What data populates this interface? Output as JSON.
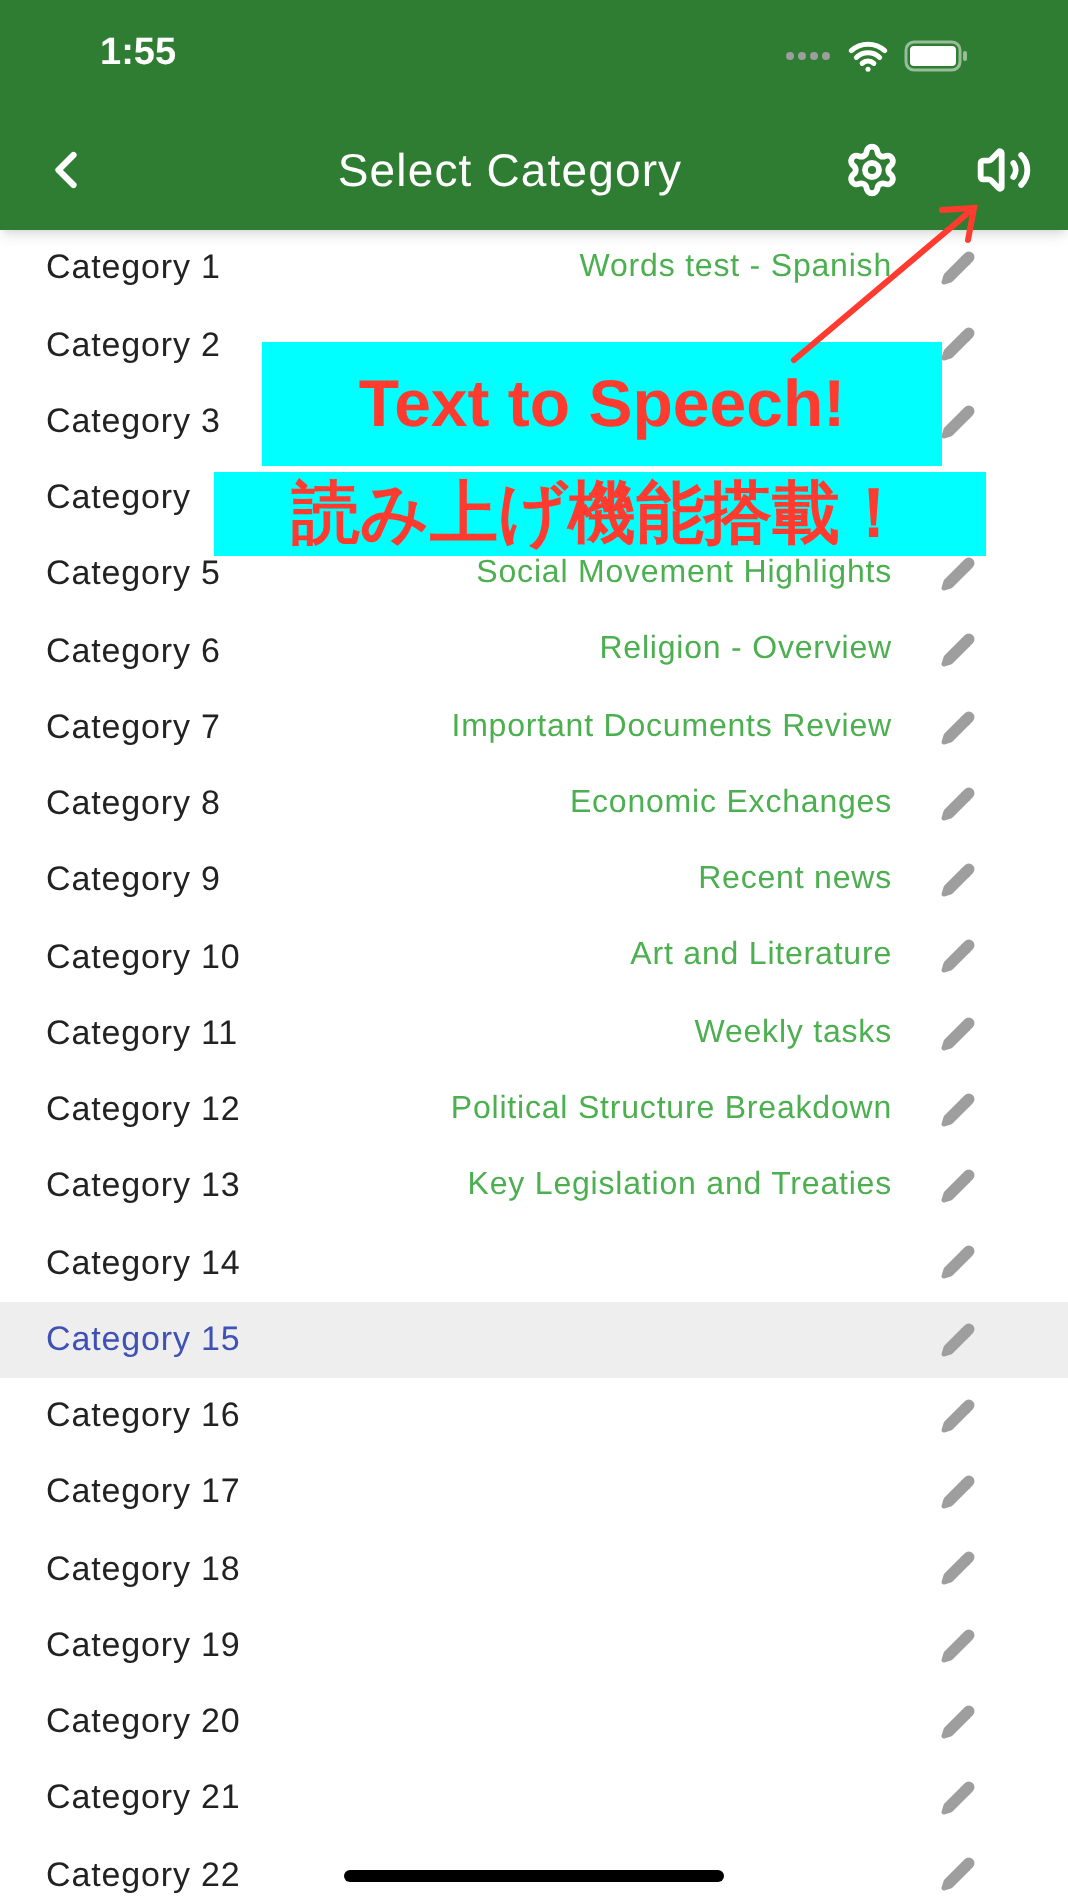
{
  "status_bar": {
    "time": "1:55"
  },
  "header": {
    "title": "Select Category"
  },
  "categories": [
    {
      "name": "Category 1",
      "description": "Words test - Spanish",
      "selected": false,
      "edit_icon": true
    },
    {
      "name": "Category 2",
      "selected": false,
      "edit_icon": true
    },
    {
      "name": "Category 3",
      "selected": false,
      "edit_icon": true
    },
    {
      "name": "Category",
      "selected": false,
      "edit_icon": false
    },
    {
      "name": "Category 5",
      "description": "Social Movement Highlights",
      "selected": false,
      "edit_icon": true
    },
    {
      "name": "Category 6",
      "description": "Religion - Overview",
      "selected": false,
      "edit_icon": true
    },
    {
      "name": "Category 7",
      "description": "Important Documents Review",
      "selected": false,
      "edit_icon": true
    },
    {
      "name": "Category 8",
      "description": "Economic Exchanges",
      "selected": false,
      "edit_icon": true
    },
    {
      "name": "Category 9",
      "description": "Recent news",
      "selected": false,
      "edit_icon": true
    },
    {
      "name": "Category 10",
      "description": "Art and Literature",
      "selected": false,
      "edit_icon": true
    },
    {
      "name": "Category 11",
      "description": "Weekly tasks",
      "selected": false,
      "edit_icon": true
    },
    {
      "name": "Category 12",
      "description": "Political Structure Breakdown",
      "selected": false,
      "edit_icon": true
    },
    {
      "name": "Category 13",
      "description": "Key Legislation and Treaties",
      "selected": false,
      "edit_icon": true
    },
    {
      "name": "Category 14",
      "selected": false,
      "edit_icon": true
    },
    {
      "name": "Category 15",
      "selected": true,
      "edit_icon": true
    },
    {
      "name": "Category 16",
      "selected": false,
      "edit_icon": true
    },
    {
      "name": "Category 17",
      "selected": false,
      "edit_icon": true
    },
    {
      "name": "Category 18",
      "selected": false,
      "edit_icon": true
    },
    {
      "name": "Category 19",
      "selected": false,
      "edit_icon": true
    },
    {
      "name": "Category 20",
      "selected": false,
      "edit_icon": true
    },
    {
      "name": "Category 21",
      "selected": false,
      "edit_icon": true
    },
    {
      "name": "Category 22",
      "selected": false,
      "edit_icon": true
    }
  ],
  "promo": {
    "headline": "Text to Speech!",
    "subheadline": "読み上げ機能搭載！"
  }
}
